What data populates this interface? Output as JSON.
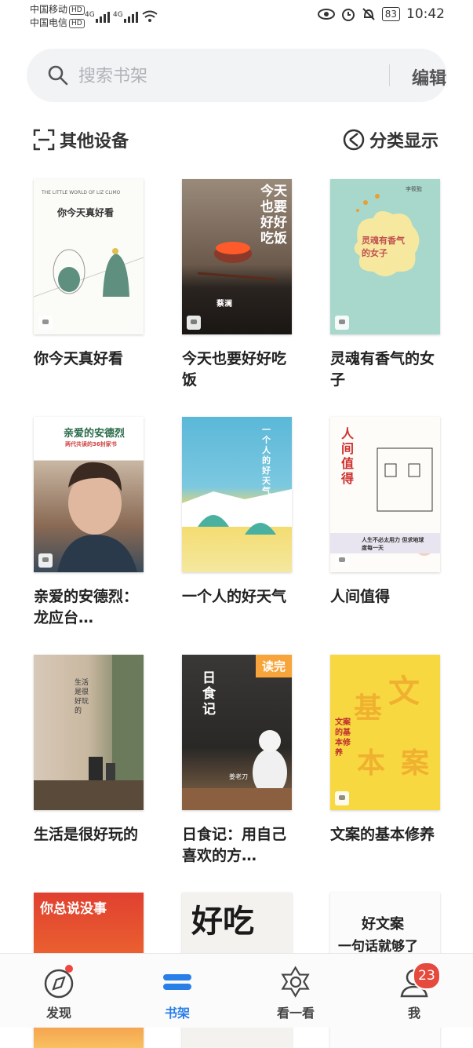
{
  "status": {
    "carrier1": "中国移动",
    "carrier2": "中国电信",
    "hd": "HD",
    "net1": "4G",
    "net2": "4G",
    "battery": "83",
    "time": "10:42"
  },
  "search": {
    "placeholder": "搜索书架",
    "edit_label": "编辑"
  },
  "toolbar": {
    "other_devices": "其他设备",
    "category_view": "分类显示"
  },
  "books": [
    {
      "title": "你今天真好看",
      "cover_text": "你今天真好看",
      "cover_sub": "THE LITTLE WORLD OF LIZ CLIMO"
    },
    {
      "title": "今天也要好好吃饭",
      "cover_text": "今天也要好好吃饭",
      "cover_sub": "蔡澜"
    },
    {
      "title": "灵魂有香气的女子",
      "cover_text": "灵魂有香气的女子",
      "cover_sub": "李筱懿"
    },
    {
      "title": "亲爱的安德烈：龙应台…",
      "cover_text": "亲爱的安德烈",
      "cover_sub": "两代共读的36封家书"
    },
    {
      "title": "一个人的好天气",
      "cover_text": "一个人的好天气",
      "cover_sub": ""
    },
    {
      "title": "人间值得",
      "cover_text": "人间值得",
      "cover_sub": "人生不必太用力 但求地球度每一天"
    },
    {
      "title": "生活是很好玩的",
      "cover_text": "生活是很好玩的",
      "cover_sub": ""
    },
    {
      "title": "日食记：用自己喜欢的方…",
      "cover_text": "日食记",
      "cover_sub": "姜老刀",
      "badge": "读完"
    },
    {
      "title": "文案的基本修养",
      "cover_text": "文案的基本修养",
      "cover_sub": ""
    },
    {
      "title": "",
      "cover_text": "你总说没事",
      "cover_sub": ""
    },
    {
      "title": "",
      "cover_text": "好吃",
      "cover_sub": ""
    },
    {
      "title": "",
      "cover_text": "好文案",
      "cover_sub": "一句话就够了"
    }
  ],
  "nav": {
    "discover": "发现",
    "bookshelf": "书架",
    "watch": "看一看",
    "me": "我",
    "me_badge": "23"
  },
  "colors": {
    "accent": "#2a7ee8",
    "badge_red": "#e64a3e",
    "read_badge": "#f7a53a"
  }
}
